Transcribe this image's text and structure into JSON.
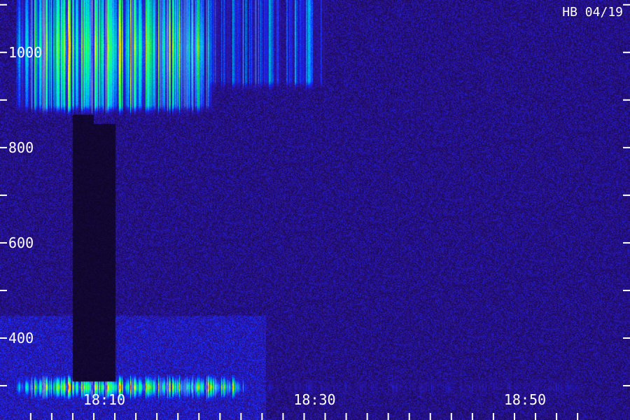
{
  "chart_data": {
    "type": "heatmap",
    "title": "",
    "xlabel": "",
    "ylabel": "",
    "stamp": "HB 04/19",
    "x_axis": {
      "unit": "time (HH:MM)",
      "range": [
        "18:03",
        "18:55"
      ],
      "labeled_ticks": [
        "18:10",
        "18:30",
        "18:50"
      ],
      "minor_tick_step_minutes": 2
    },
    "y_axis": {
      "range": [
        300,
        1110
      ],
      "labeled_ticks": [
        400,
        600,
        800,
        1000
      ],
      "minor_tick_step": 100
    },
    "colormap": [
      "#000000",
      "#1a0a4a",
      "#2b1090",
      "#1a2bff",
      "#00b4ff",
      "#00ffb0",
      "#40ff40",
      "#ffff00",
      "#ff9a00",
      "#ff1a00"
    ],
    "noise_floor_level": 0.2,
    "features": [
      {
        "kind": "broadband_emission",
        "start": "18:03",
        "end": "18:19",
        "freq_low": 890,
        "freq_high": 1110,
        "peak_level": 0.95
      },
      {
        "kind": "diffuse_tail",
        "start": "18:19",
        "end": "18:30",
        "freq_low": 940,
        "freq_high": 1110,
        "peak_level": 0.5
      },
      {
        "kind": "low_band_emission",
        "start": "18:03",
        "end": "18:22",
        "freq_low": 300,
        "freq_high": 295,
        "peak_level": 1.0
      },
      {
        "kind": "low_band_trace",
        "start": "18:22",
        "end": "18:55",
        "freq_low": 300,
        "freq_high": 295,
        "peak_level": 0.3
      },
      {
        "kind": "absorption_dropout",
        "start": "18:07",
        "end": "18:09",
        "freq_low": 310,
        "freq_high": 870,
        "level": 0.02
      },
      {
        "kind": "absorption_dropout",
        "start": "18:09",
        "end": "18:11",
        "freq_low": 310,
        "freq_high": 850,
        "level": 0.02
      }
    ]
  }
}
